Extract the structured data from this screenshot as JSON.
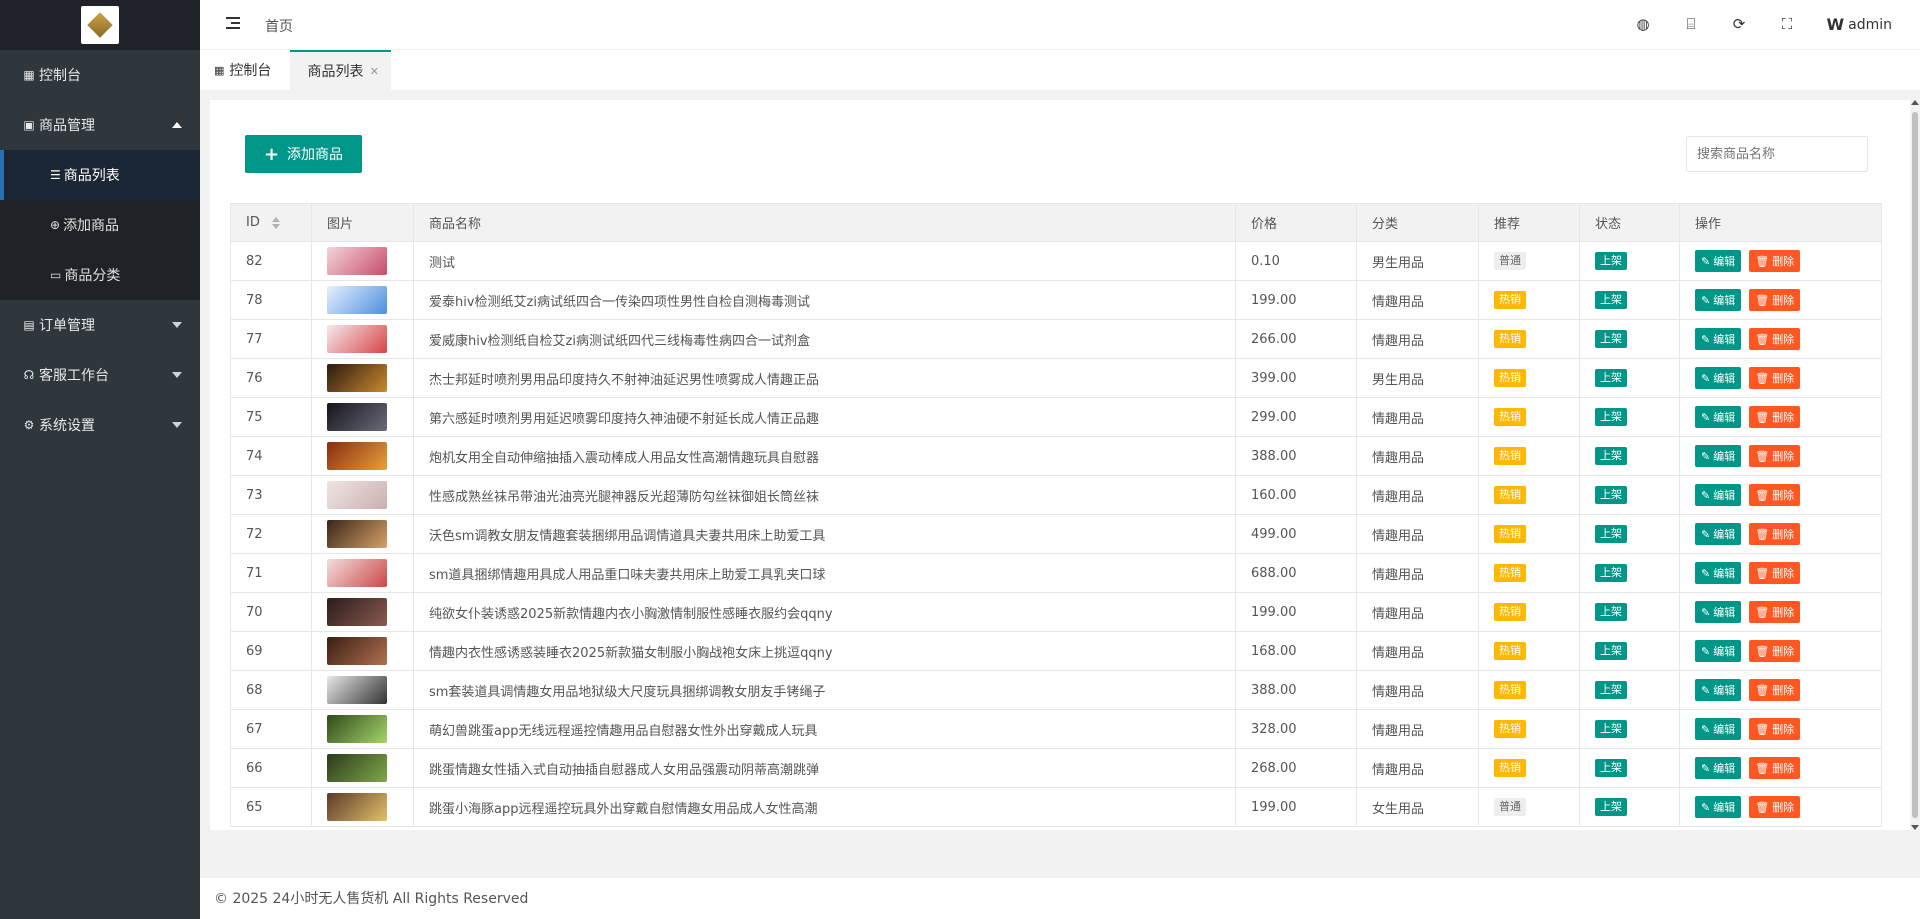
{
  "sidebar": {
    "items": [
      {
        "label": "控制台",
        "icon": "dashboard-icon"
      },
      {
        "label": "商品管理",
        "icon": "shop-icon",
        "expanded": true,
        "children": [
          {
            "label": "商品列表",
            "icon": "list-icon",
            "active": true
          },
          {
            "label": "添加商品",
            "icon": "plus-circle-icon"
          },
          {
            "label": "商品分类",
            "icon": "folder-icon"
          }
        ]
      },
      {
        "label": "订单管理",
        "icon": "order-icon"
      },
      {
        "label": "客服工作台",
        "icon": "headset-icon"
      },
      {
        "label": "系统设置",
        "icon": "gear-icon"
      }
    ]
  },
  "header": {
    "breadcrumb": "首页",
    "user": "admin"
  },
  "tabs": {
    "home": "控制台",
    "active": "商品列表"
  },
  "toolbar": {
    "add_label": "添加商品",
    "search_placeholder": "搜索商品名称"
  },
  "table": {
    "columns": [
      "ID",
      "图片",
      "商品名称",
      "价格",
      "分类",
      "推荐",
      "状态",
      "操作"
    ],
    "edit_label": "编辑",
    "delete_label": "删除",
    "rows": [
      {
        "id": "82",
        "name": "测试",
        "price": "0.10",
        "category": "男生用品",
        "recommend": "普通",
        "status": "上架",
        "thumb": [
          "#f3d4d8",
          "#c84d6a"
        ]
      },
      {
        "id": "78",
        "name": "爱泰hiv检测纸艾zi病试纸四合一传染四项性男性自检自测梅毒测试",
        "price": "199.00",
        "category": "情趣用品",
        "recommend": "热销",
        "status": "上架",
        "thumb": [
          "#e6f0fb",
          "#4c8fe0"
        ]
      },
      {
        "id": "77",
        "name": "爱威康hiv检测纸自检艾zi病测试纸四代三线梅毒性病四合一试剂盒",
        "price": "266.00",
        "category": "情趣用品",
        "recommend": "热销",
        "status": "上架",
        "thumb": [
          "#f5e9f0",
          "#d64545"
        ]
      },
      {
        "id": "76",
        "name": "杰士邦延时喷剂男用品印度持久不射神油延迟男性喷雾成人情趣正品",
        "price": "399.00",
        "category": "男生用品",
        "recommend": "热销",
        "status": "上架",
        "thumb": [
          "#2a1a10",
          "#c98a2e"
        ]
      },
      {
        "id": "75",
        "name": "第六感延时喷剂男用延迟喷雾印度持久神油硬不射延长成人情正品趣",
        "price": "299.00",
        "category": "情趣用品",
        "recommend": "热销",
        "status": "上架",
        "thumb": [
          "#15151c",
          "#6b6b7a"
        ]
      },
      {
        "id": "74",
        "name": "炮机女用全自动伸缩抽插入震动棒成人用品女性高潮情趣玩具自慰器",
        "price": "388.00",
        "category": "情趣用品",
        "recommend": "热销",
        "status": "上架",
        "thumb": [
          "#8a2b10",
          "#e8a23a"
        ]
      },
      {
        "id": "73",
        "name": "性感成熟丝袜吊带油光油亮光腿神器反光超薄防勾丝袜御姐长筒丝袜",
        "price": "160.00",
        "category": "情趣用品",
        "recommend": "热销",
        "status": "上架",
        "thumb": [
          "#f0e4e4",
          "#cbb0b0"
        ]
      },
      {
        "id": "72",
        "name": "沃色sm调教女朋友情趣套装捆绑用品调情道具夫妻共用床上助爱工具",
        "price": "499.00",
        "category": "情趣用品",
        "recommend": "热销",
        "status": "上架",
        "thumb": [
          "#3a2416",
          "#d6a26a"
        ]
      },
      {
        "id": "71",
        "name": "sm道具捆绑情趣用具成人用品重口味夫妻共用床上助爱工具乳夹口球",
        "price": "688.00",
        "category": "情趣用品",
        "recommend": "热销",
        "status": "上架",
        "thumb": [
          "#f4dede",
          "#c94848"
        ]
      },
      {
        "id": "70",
        "name": "纯欲女仆装诱惑2025新款情趣内衣小胸激情制服性感睡衣服约会qqny",
        "price": "199.00",
        "category": "情趣用品",
        "recommend": "热销",
        "status": "上架",
        "thumb": [
          "#2a1c1c",
          "#8a5a50"
        ]
      },
      {
        "id": "69",
        "name": "情趣内衣性感诱惑装睡衣2025新款猫女制服小胸战袍女床上挑逗qqny",
        "price": "168.00",
        "category": "情趣用品",
        "recommend": "热销",
        "status": "上架",
        "thumb": [
          "#3a1e14",
          "#b07050"
        ]
      },
      {
        "id": "68",
        "name": "sm套装道具调情趣女用品地狱级大尺度玩具捆绑调教女朋友手铐绳子",
        "price": "388.00",
        "category": "情趣用品",
        "recommend": "热销",
        "status": "上架",
        "thumb": [
          "#e8e8e8",
          "#333333"
        ]
      },
      {
        "id": "67",
        "name": "萌幻兽跳蛋app无线远程遥控情趣用品自慰器女性外出穿戴成人玩具",
        "price": "328.00",
        "category": "情趣用品",
        "recommend": "热销",
        "status": "上架",
        "thumb": [
          "#2f4a1a",
          "#a6d46a"
        ]
      },
      {
        "id": "66",
        "name": "跳蛋情趣女性插入式自动抽插自慰器成人女用品强震动阴蒂高潮跳弹",
        "price": "268.00",
        "category": "情趣用品",
        "recommend": "热销",
        "status": "上架",
        "thumb": [
          "#2c3a1c",
          "#7fa84a"
        ]
      },
      {
        "id": "65",
        "name": "跳蛋小海豚app远程遥控玩具外出穿戴自慰情趣女用品成人女性高潮",
        "price": "199.00",
        "category": "女生用品",
        "recommend": "普通",
        "status": "上架",
        "thumb": [
          "#5a3a2a",
          "#e2c16a"
        ]
      }
    ]
  },
  "footer": {
    "copyright": "© 2025 24小时无人售货机 All Rights Reserved"
  },
  "colors": {
    "primary": "#009688",
    "danger": "#ff5722",
    "warning": "#ffb800",
    "sidebar": "#2f363c"
  }
}
